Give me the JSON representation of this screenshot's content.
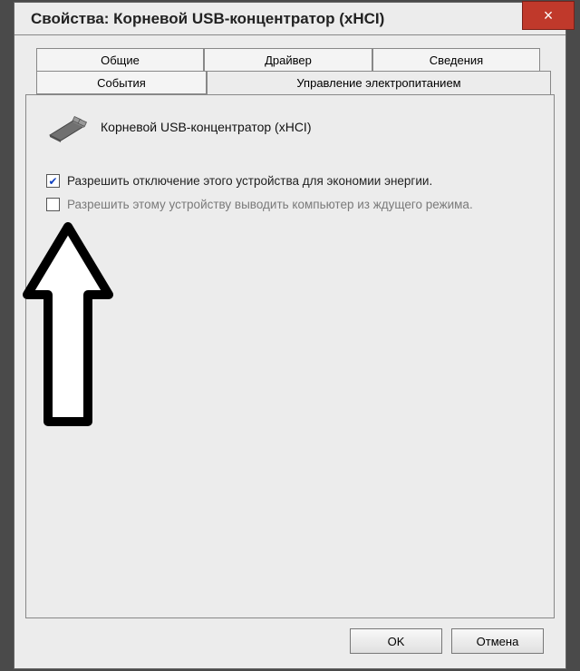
{
  "window": {
    "title": "Свойства: Корневой USB-концентратор (xHCI)"
  },
  "tabs": {
    "general": "Общие",
    "driver": "Драйвер",
    "details": "Сведения",
    "events": "События",
    "power": "Управление электропитанием"
  },
  "device": {
    "name": "Корневой USB-концентратор (xHCI)"
  },
  "options": {
    "allow_off": "Разрешить отключение этого устройства для экономии энергии.",
    "allow_wake": "Разрешить этому устройству выводить компьютер из ждущего режима."
  },
  "buttons": {
    "ok": "OK",
    "cancel": "Отмена",
    "close": "×"
  }
}
